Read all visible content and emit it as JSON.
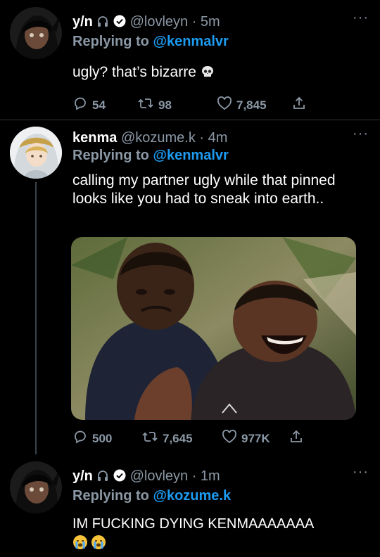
{
  "tweets": [
    {
      "display_name": "y/n",
      "handle": "@lovleyn",
      "time": "· 5m",
      "replying_label": "Replying to",
      "replying_to": "@kenmalvr",
      "text": "ugly? that’s bizarre",
      "text_emoji": "skull-emoji",
      "replies": "54",
      "retweets": "98",
      "likes": "7,845"
    },
    {
      "display_name": "kenma",
      "handle": "@kozume.k",
      "time": "· 4m",
      "replying_label": "Replying to",
      "replying_to": "@kenmalvr",
      "text": "calling my partner ugly while that pinned looks like you had to sneak into earth..",
      "media": "photo of two men, one crying and one laughing",
      "replies": "500",
      "retweets": "7,645",
      "likes": "977K"
    },
    {
      "display_name": "y/n",
      "handle": "@lovleyn",
      "time": "· 1m",
      "replying_label": "Replying to",
      "replying_to": "@kozume.k",
      "text": "IM FUCKING DYING KENMAAAAAAA",
      "text_emoji": "loudly-crying-face-emoji"
    }
  ],
  "more_label": "···",
  "colors": {
    "background": "#000000",
    "secondary_text": "#8b98a5",
    "link": "#1d9bf0",
    "divider": "#2f3336"
  }
}
